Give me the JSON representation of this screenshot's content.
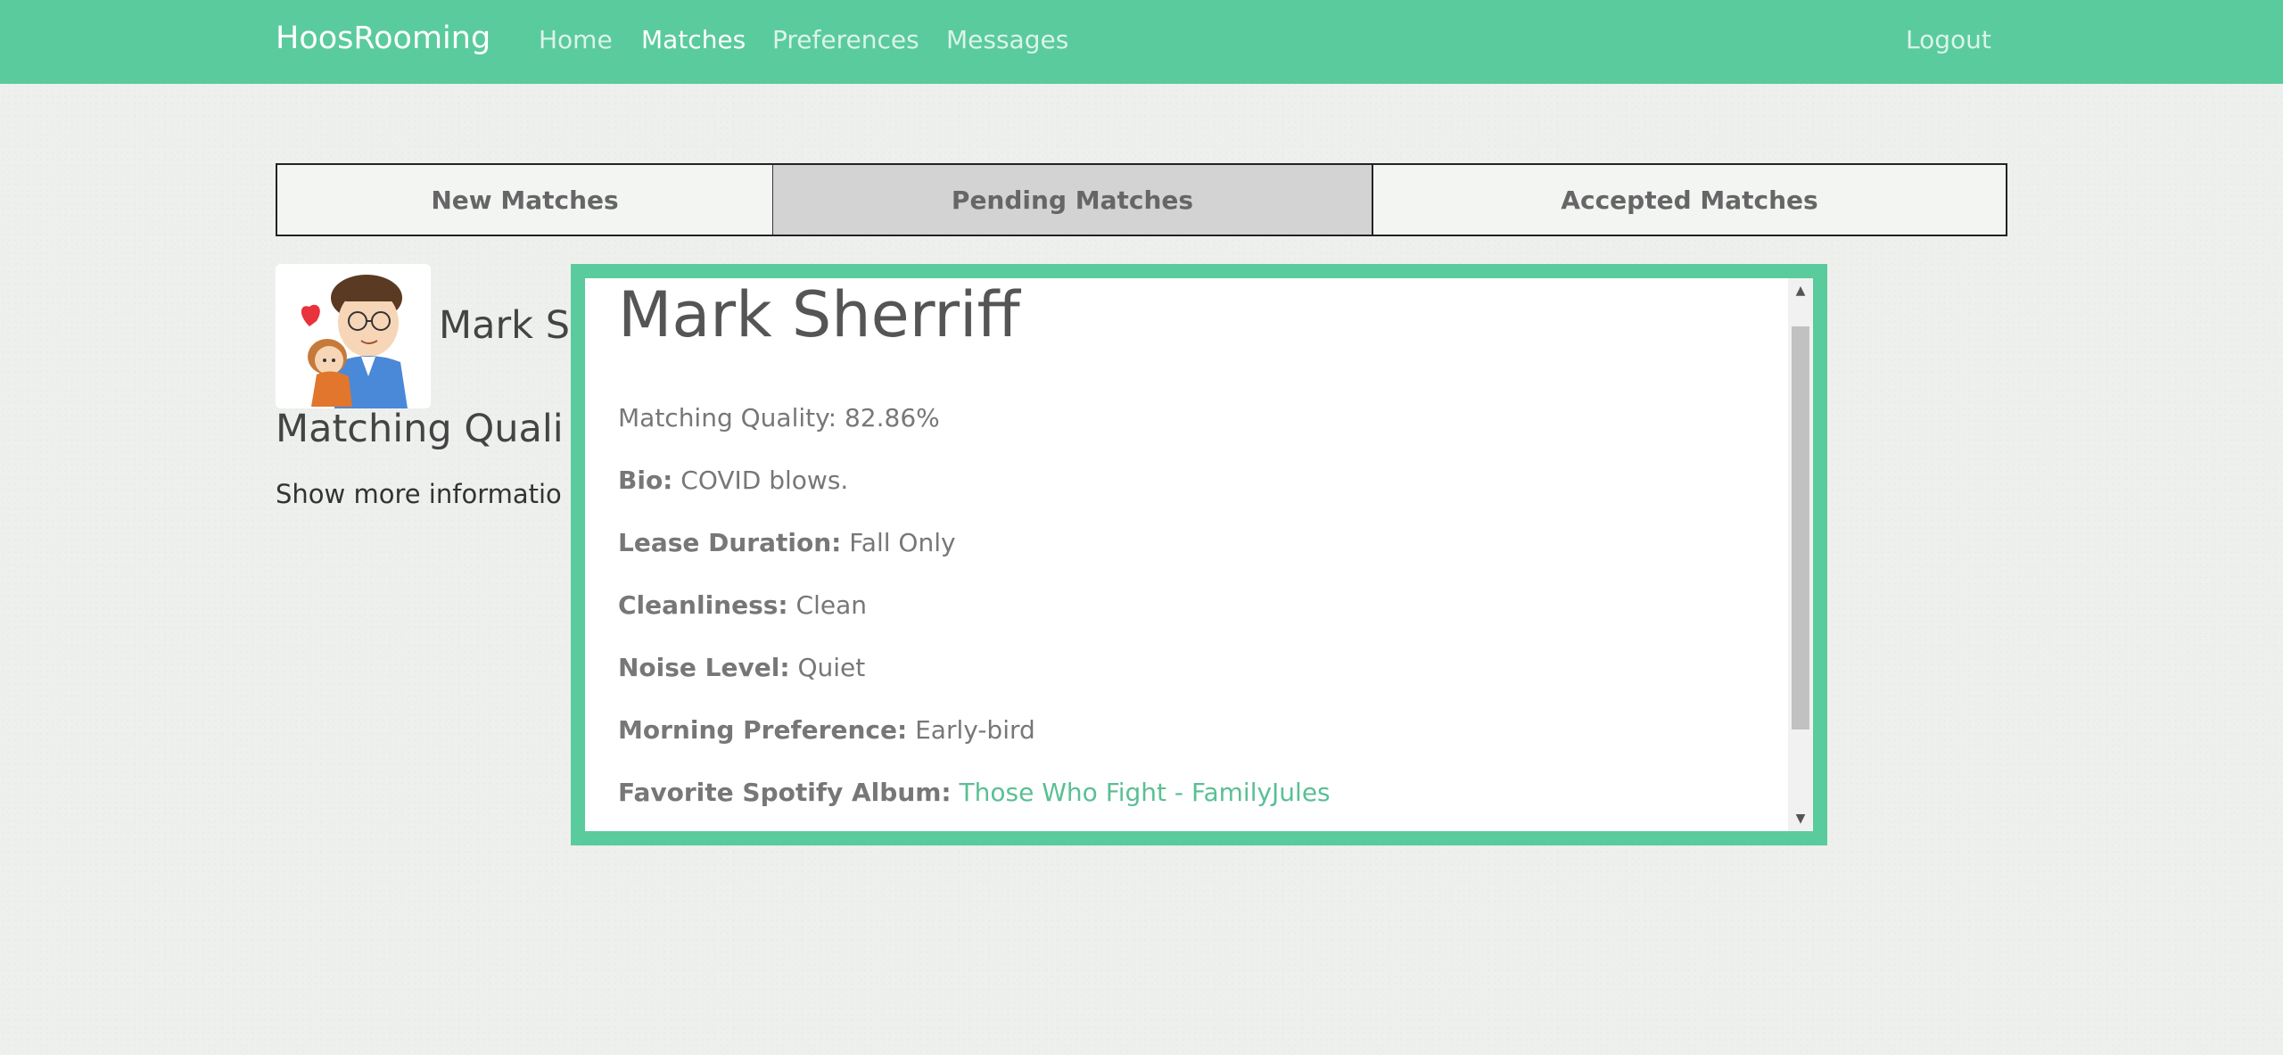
{
  "navbar": {
    "brand": "HoosRooming",
    "links": [
      "Home",
      "Matches",
      "Preferences",
      "Messages"
    ],
    "logout": "Logout",
    "accent_color": "#5acb9c"
  },
  "tabs": [
    "New Matches",
    "Pending Matches",
    "Accepted Matches"
  ],
  "active_tab": "Pending Matches",
  "card": {
    "name_partial": "Mark S",
    "quality_partial": "Matching Quali",
    "more_partial": "Show more informatio"
  },
  "modal": {
    "name": "Mark Sherriff",
    "quality": "Matching Quality: 82.86%",
    "fields": [
      {
        "label": "Bio:",
        "value": "COVID blows."
      },
      {
        "label": "Lease Duration:",
        "value": "Fall Only"
      },
      {
        "label": "Cleanliness:",
        "value": "Clean"
      },
      {
        "label": "Noise Level:",
        "value": "Quiet"
      },
      {
        "label": "Morning Preference:",
        "value": "Early-bird"
      }
    ],
    "spotify": {
      "label": "Favorite Spotify Album:",
      "value": "Those Who Fight - FamilyJules"
    }
  },
  "scrollbar": {
    "up": "▲",
    "down": "▼",
    "position": 0.0
  }
}
